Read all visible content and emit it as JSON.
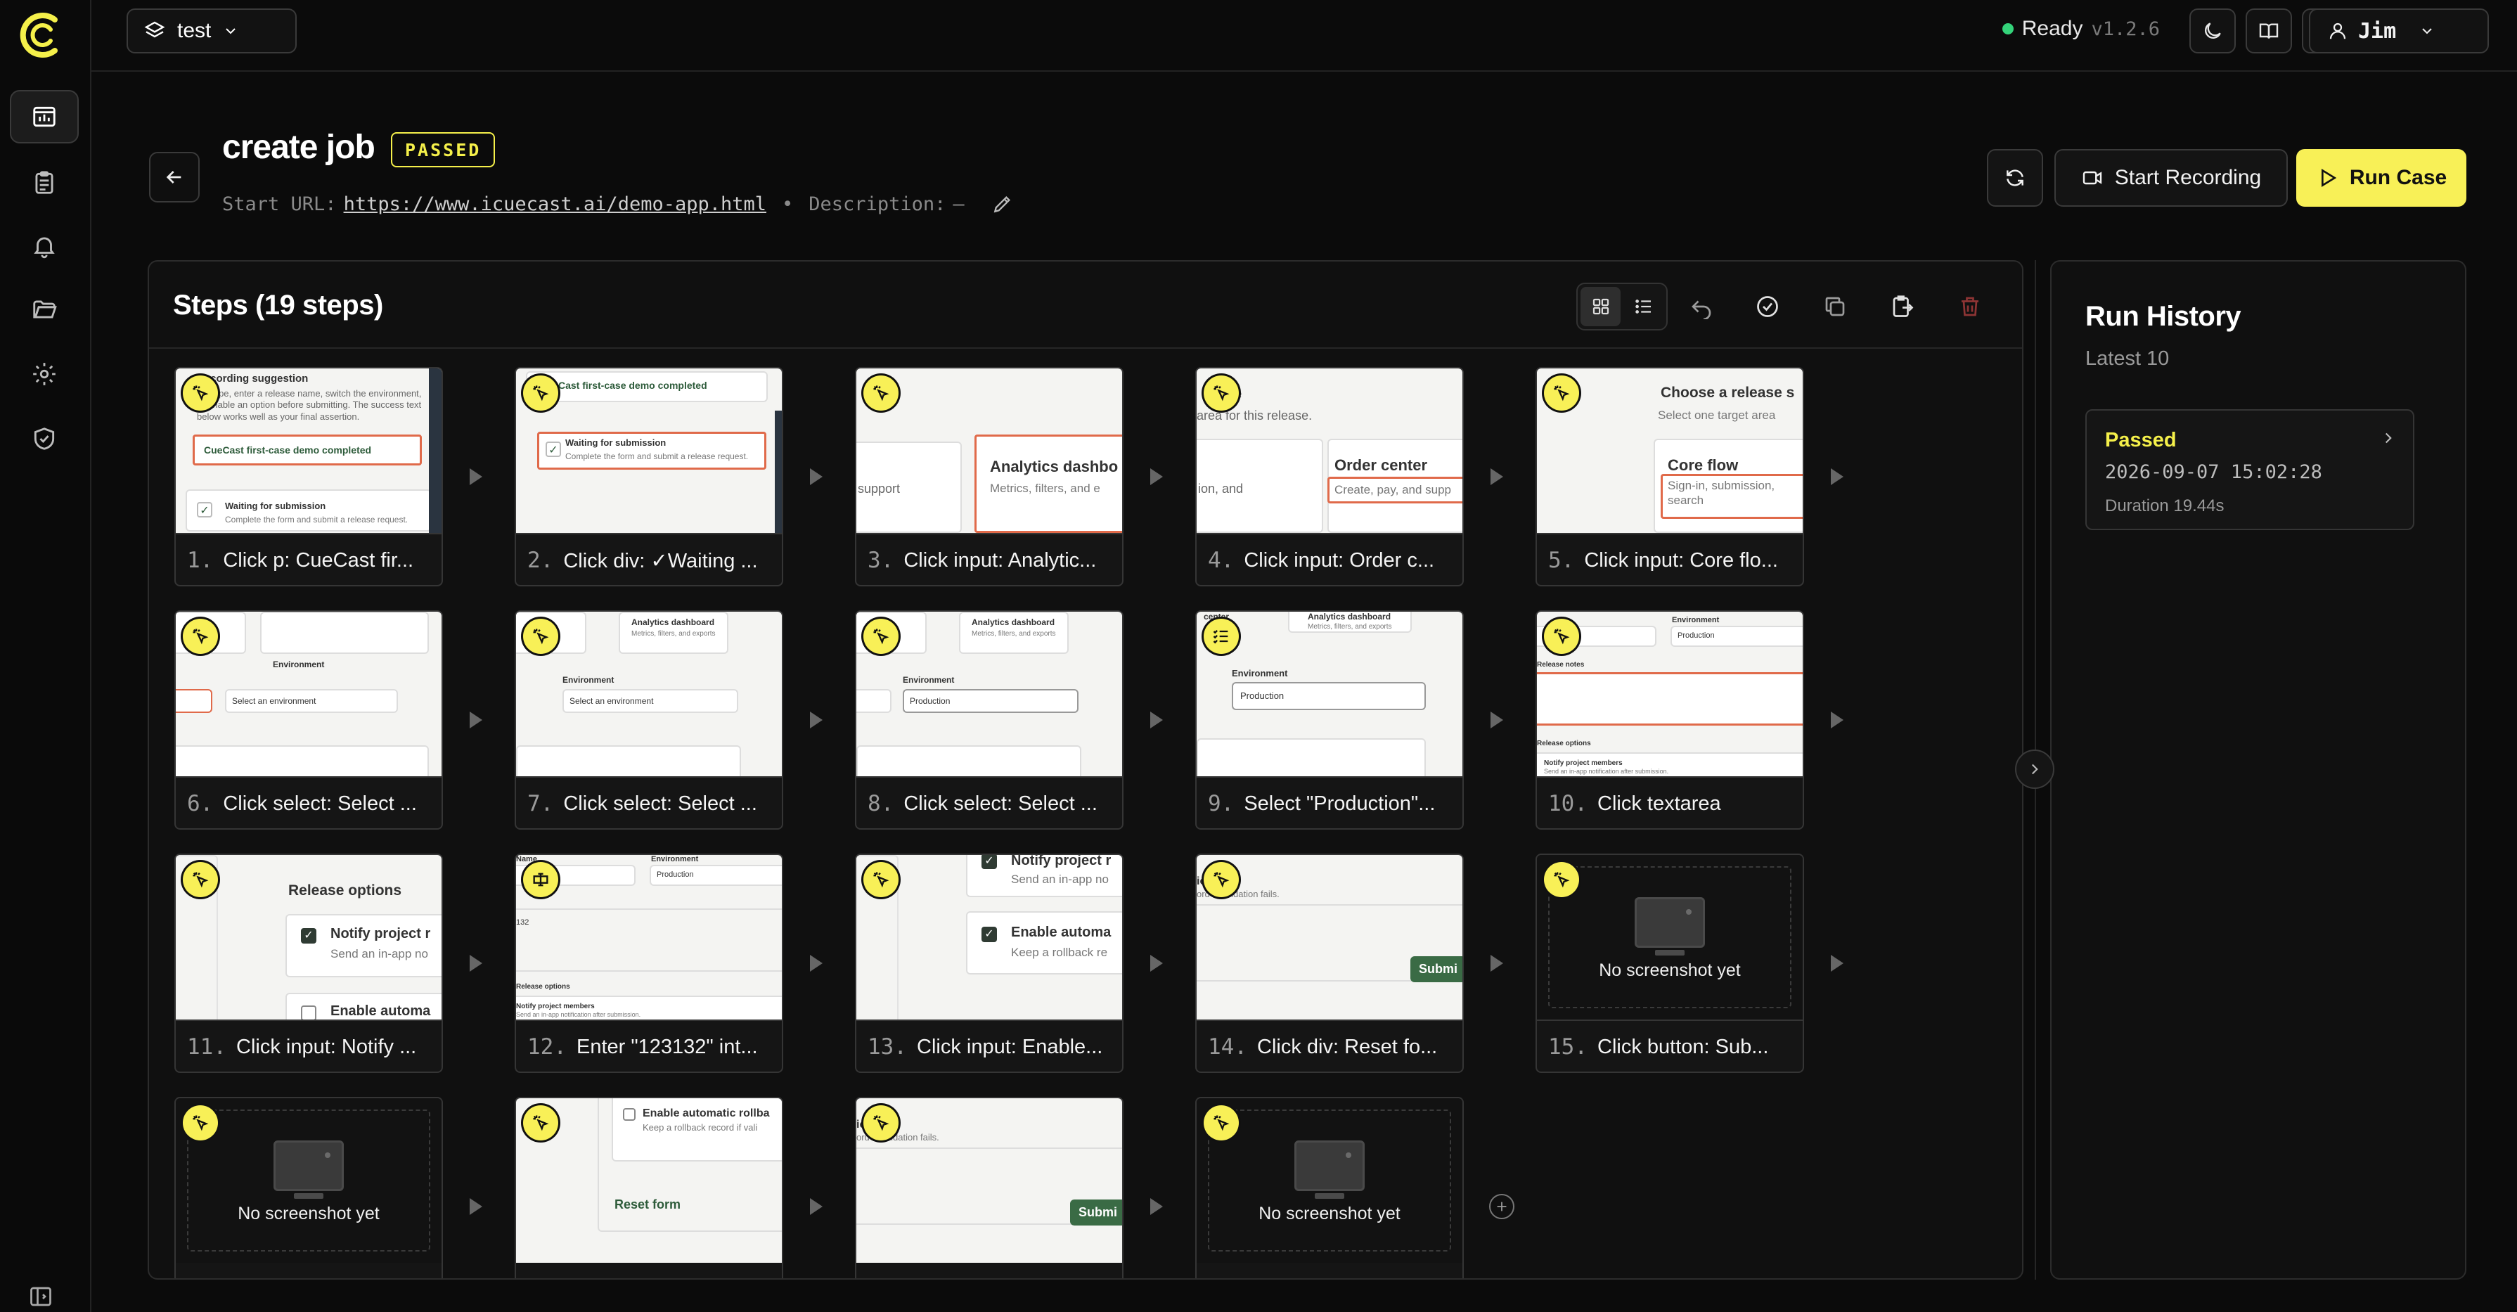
{
  "app": {
    "project": "test",
    "status": "Ready",
    "version": "v1.2.6",
    "user": "Jim"
  },
  "case": {
    "title": "create job",
    "badge": "PASSED",
    "start_url_label": "Start URL:",
    "start_url": "https://www.icuecast.ai/demo-app.html",
    "separator": "•",
    "description_label": "Description:",
    "description": "—"
  },
  "actions": {
    "start_recording": "Start Recording",
    "run_case": "Run Case"
  },
  "steps_panel": {
    "title": "Steps (19 steps)",
    "steps": [
      {
        "n": "1.",
        "label": "Click p: CueCast fir..."
      },
      {
        "n": "2.",
        "label": "Click div: ✓Waiting ..."
      },
      {
        "n": "3.",
        "label": "Click input: Analytic..."
      },
      {
        "n": "4.",
        "label": "Click input: Order c..."
      },
      {
        "n": "5.",
        "label": "Click input: Core flo..."
      },
      {
        "n": "6.",
        "label": "Click select: Select ..."
      },
      {
        "n": "7.",
        "label": "Click select: Select ..."
      },
      {
        "n": "8.",
        "label": "Click select: Select ..."
      },
      {
        "n": "9.",
        "label": "Select \"Production\"..."
      },
      {
        "n": "10.",
        "label": "Click textarea"
      },
      {
        "n": "11.",
        "label": "Click input: Notify ..."
      },
      {
        "n": "12.",
        "label": "Enter \"123132\" int..."
      },
      {
        "n": "13.",
        "label": "Click input: Enable..."
      },
      {
        "n": "14.",
        "label": "Click div: Reset fo..."
      },
      {
        "n": "15.",
        "label": "Click button: Sub..."
      }
    ],
    "no_screenshot": "No screenshot yet",
    "shot_text": {
      "s1_title": "Recording suggestion",
      "s1_body": "a scope, enter a release name, switch the environment, or enable an option before submitting. The success text below works well as your final assertion.",
      "s1_box": "CueCast first-case demo completed",
      "s1_wait": "Waiting for submission",
      "s1_wait_sub": "Complete the form and submit a release request.",
      "s2_top": "Cast first-case demo completed",
      "s2_wait": "Waiting for submission",
      "s2_wait_sub": "Complete the form and submit a release request.",
      "s3_left": "support",
      "s3_title": "Analytics dashbo",
      "s3_sub": "Metrics, filters, and e",
      "s4_top": "e",
      "s4_sub": "area for this release.",
      "s4_left": "ion, and",
      "s4_title": "Order center",
      "s4_box": "Create, pay, and supp",
      "s5_title": "Choose a release s",
      "s5_sub": "Select one target area",
      "s5_card": "Core flow",
      "s5_box": "Sign-in, submission, search",
      "env_title": "Environment",
      "env_select": "Select an environment",
      "env_prod": "Production",
      "analytics": "Analytics dashboard",
      "analytics_sub": "Metrics, filters, and exports",
      "center": "center",
      "release_notes": "Release notes",
      "release_options": "Release options",
      "notify": "Notify project members",
      "notify_sub": "Send an in-app notification after submission.",
      "s11_notify": "Notify project r",
      "s11_notify_sub": "Send an in-app no",
      "s11_enable": "Enable automa",
      "s12_name": "Name",
      "s12_val": "132",
      "s13_notify": "Notify project r",
      "s13_notify_sub": "Send an in-app no",
      "s13_enable": "Enable automa",
      "s13_enable_sub": "Keep a rollback re",
      "s14_title": "ick",
      "s14_sub": "ord if validation fails.",
      "submit": "Submi",
      "s17_enable": "Enable automatic rollba",
      "s17_sub": "Keep a rollback record if vali",
      "reset": "Reset form"
    }
  },
  "history": {
    "title": "Run History",
    "subtitle": "Latest 10",
    "runs": [
      {
        "status": "Passed",
        "time": "2026-09-07 15:02:28",
        "duration": "Duration 19.44s"
      }
    ]
  },
  "colors": {
    "accent": "#f8f057",
    "success": "#34d37a",
    "danger": "#8e3434",
    "background": "#0b0b0b"
  },
  "icons": {
    "click": "pointer-click-icon",
    "select": "list-check-icon",
    "type": "keyboard-icon"
  }
}
